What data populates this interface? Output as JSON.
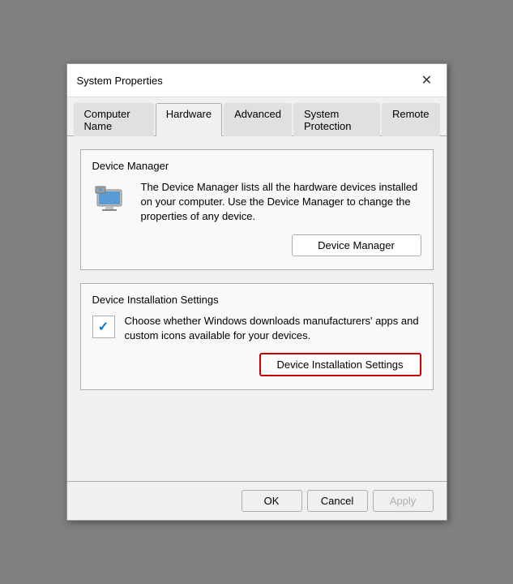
{
  "window": {
    "title": "System Properties"
  },
  "tabs": [
    {
      "label": "Computer Name",
      "active": false
    },
    {
      "label": "Hardware",
      "active": true
    },
    {
      "label": "Advanced",
      "active": false
    },
    {
      "label": "System Protection",
      "active": false
    },
    {
      "label": "Remote",
      "active": false
    }
  ],
  "device_manager_section": {
    "title": "Device Manager",
    "description": "The Device Manager lists all the hardware devices installed on your computer. Use the Device Manager to change the properties of any device.",
    "button_label": "Device Manager"
  },
  "device_installation_section": {
    "title": "Device Installation Settings",
    "description": "Choose whether Windows downloads manufacturers' apps and custom icons available for your devices.",
    "button_label": "Device Installation Settings"
  },
  "footer": {
    "ok_label": "OK",
    "cancel_label": "Cancel",
    "apply_label": "Apply"
  }
}
